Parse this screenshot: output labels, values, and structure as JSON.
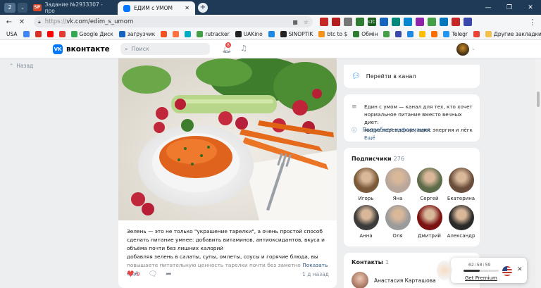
{
  "browser": {
    "tab_count": "2",
    "tabs": [
      {
        "label": "Задание №2933307 - про",
        "active": false
      },
      {
        "label": "ЕДИМ с УМОМ",
        "active": true
      }
    ],
    "url_host": "https://",
    "url_path": "vk.com/edim_s_umom",
    "window_buttons": [
      "—",
      "❐",
      "✕"
    ]
  },
  "bookmarks": {
    "items": [
      "USA",
      "",
      "",
      "",
      "",
      "Google Диск",
      "загрузчик",
      "",
      "",
      "",
      "rutracker",
      "UAKino",
      "",
      "SINOPTIK",
      "btc to $",
      "Обмін",
      "",
      "",
      "",
      "",
      "",
      "Telegr",
      ""
    ],
    "other": "Другие закладки",
    "colors": [
      "#777777",
      "#4285f4",
      "#d93025",
      "#ff0000",
      "#e53935",
      "#34a853",
      "#1565c0",
      "#f4511e",
      "#ff7043",
      "#00acc1",
      "#43a047",
      "#212121",
      "#1e88e5",
      "#222222",
      "#f7931a",
      "#2e7d32",
      "#43a047",
      "#3949ab",
      "#1e88e5",
      "#fbbc04",
      "#ff6f00",
      "#2196f3",
      "#ea4335"
    ]
  },
  "extensions": {
    "labels": [
      "",
      "",
      "",
      "",
      "LTC",
      "",
      "",
      "",
      "",
      "",
      "",
      "",
      ""
    ],
    "colors": [
      "#c62828",
      "#b71c1c",
      "#777777",
      "#2e7d32",
      "#1b5e20",
      "#1565c0",
      "#00897b",
      "#0288d1",
      "#8e24aa",
      "#43a047",
      "#0277bd",
      "#c62828",
      "#3949ab"
    ]
  },
  "vk": {
    "logo_text": "вконтакте",
    "logo_mark": "VK",
    "search_placeholder": "Поиск",
    "notif_count": "8",
    "back_label": "Назад"
  },
  "post": {
    "text_lines": [
      "Зелень — это не только \"украшение тарелки\", а очень простой способ",
      "сделать питание умнее: добавить витаминов, антиоксидантов, вкуса и",
      "объёма почти без лишних калорий",
      "добавляя зелень в салаты, супы, омлеты, соусы и горячие блюда, вы"
    ],
    "last_line": "повышаете питательную ценность тарелки почти без заметно",
    "show_more": "Показать ещё",
    "likes": "9",
    "time": "1 д назад"
  },
  "channel": {
    "go_label": "Перейти в канал",
    "description_lines": [
      "Един с умом — канал для тех, кто хочет",
      "нормальное питание вместо вечных диет:",
      "минус переедание, плюс энергия и лёгк"
    ],
    "more_label": "Ещё",
    "detail_label": "Подробная информация"
  },
  "subscribers": {
    "title": "Подписчики",
    "count": "276",
    "people": [
      {
        "name": "Игорь",
        "color": "#7a5a3a"
      },
      {
        "name": "Яна",
        "color": "#b9a79b"
      },
      {
        "name": "Сергей",
        "color": "#5d6b4a"
      },
      {
        "name": "Екатерина",
        "color": "#6a4d3a"
      },
      {
        "name": "Анна",
        "color": "#3b3b3b"
      },
      {
        "name": "Оля",
        "color": "#9b9b9b"
      },
      {
        "name": "Дмитрий",
        "color": "#7a1212"
      },
      {
        "name": "Александр",
        "color": "#2a2a2a"
      }
    ]
  },
  "contacts": {
    "title": "Контакты",
    "count": "1",
    "name": "Анастасия Карташова"
  },
  "player": {
    "time": "02:50:59",
    "progress": 0.45,
    "premium": "Get Premium"
  }
}
